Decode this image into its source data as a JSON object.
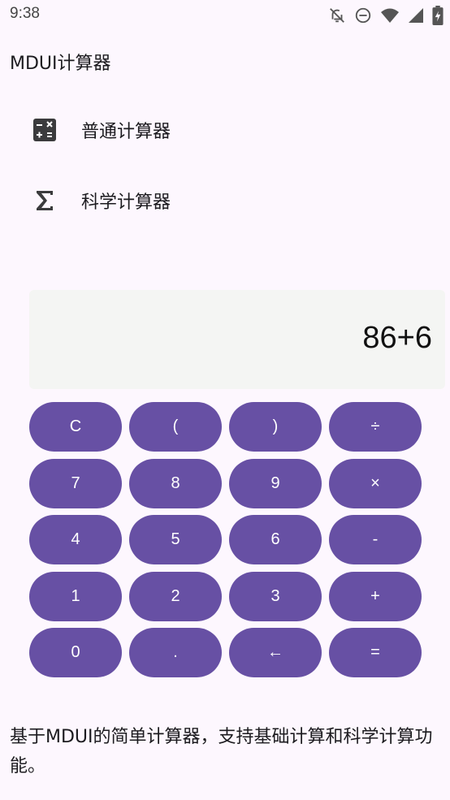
{
  "status_bar": {
    "time": "9:38",
    "icons": [
      "bell-off-icon",
      "do-not-disturb-icon",
      "wifi-icon",
      "signal-icon",
      "battery-icon"
    ]
  },
  "app": {
    "title": "MDUI计算器"
  },
  "menu": {
    "items": [
      {
        "label": "普通计算器",
        "icon": "calculator-icon"
      },
      {
        "label": "科学计算器",
        "icon": "sigma-icon"
      }
    ]
  },
  "display": {
    "value": "86+6"
  },
  "keypad": {
    "keys": [
      "C",
      "(",
      ")",
      "÷",
      "7",
      "8",
      "9",
      "×",
      "4",
      "5",
      "6",
      "-",
      "1",
      "2",
      "3",
      "+",
      "0",
      ".",
      "←",
      "="
    ]
  },
  "footer": {
    "description": "基于MDUI的简单计算器，支持基础计算和科学计算功能。"
  },
  "colors": {
    "background": "#fdf7fe",
    "key_background": "#6750a4",
    "key_text": "#ffffff",
    "display_background": "#f4f5f3"
  }
}
